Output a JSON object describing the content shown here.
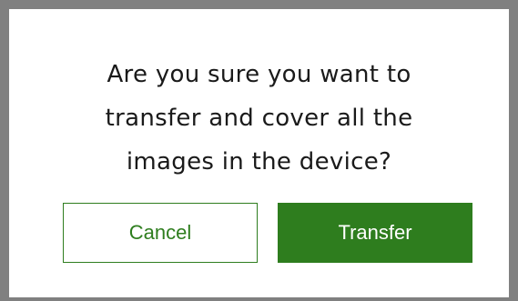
{
  "dialog": {
    "message_lines": [
      "Are you sure you want to",
      "transfer and cover all the",
      "images in the device?"
    ],
    "cancel_label": "Cancel",
    "confirm_label": "Transfer"
  },
  "colors": {
    "accent": "#2e7d1e",
    "backdrop": "#808080",
    "dialog_bg": "#ffffff",
    "text": "#1a1a1a"
  }
}
